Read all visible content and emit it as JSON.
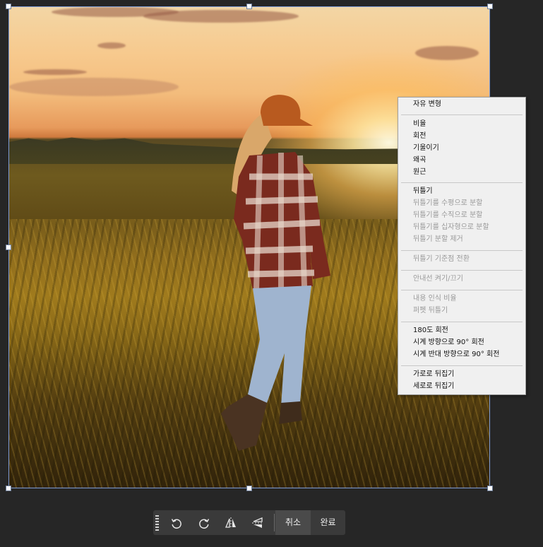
{
  "context_menu": {
    "free_transform": "자유 변형",
    "scale": "비율",
    "rotate": "회전",
    "skew": "기울이기",
    "distort": "왜곡",
    "perspective": "원근",
    "warp": "뒤틀기",
    "split_warp_horizontal": "뒤틀기를 수평으로 분할",
    "split_warp_vertical": "뒤틀기를 수직으로 분할",
    "split_warp_crosswise": "뒤틀기를 십자형으로 분할",
    "remove_warp_split": "뒤틀기 분할 제거",
    "toggle_warp_reference": "뒤틀기 기준점 전환",
    "toggle_guides": "안내선 켜기/끄기",
    "content_aware_scale": "내용 인식 비율",
    "puppet_warp": "퍼펫 뒤틀기",
    "rotate_180": "180도 회전",
    "rotate_90_cw": "시계 방향으로 90° 회전",
    "rotate_90_ccw": "시계 반대 방향으로 90° 회전",
    "flip_horizontal": "가로로 뒤집기",
    "flip_vertical": "세로로 뒤집기"
  },
  "toolbar": {
    "cancel_label": "취소",
    "done_label": "완료",
    "icons": [
      "grip-icon",
      "rotate-ccw-icon",
      "rotate-cw-icon",
      "flip-horizontal-icon",
      "flip-vertical-icon"
    ]
  }
}
